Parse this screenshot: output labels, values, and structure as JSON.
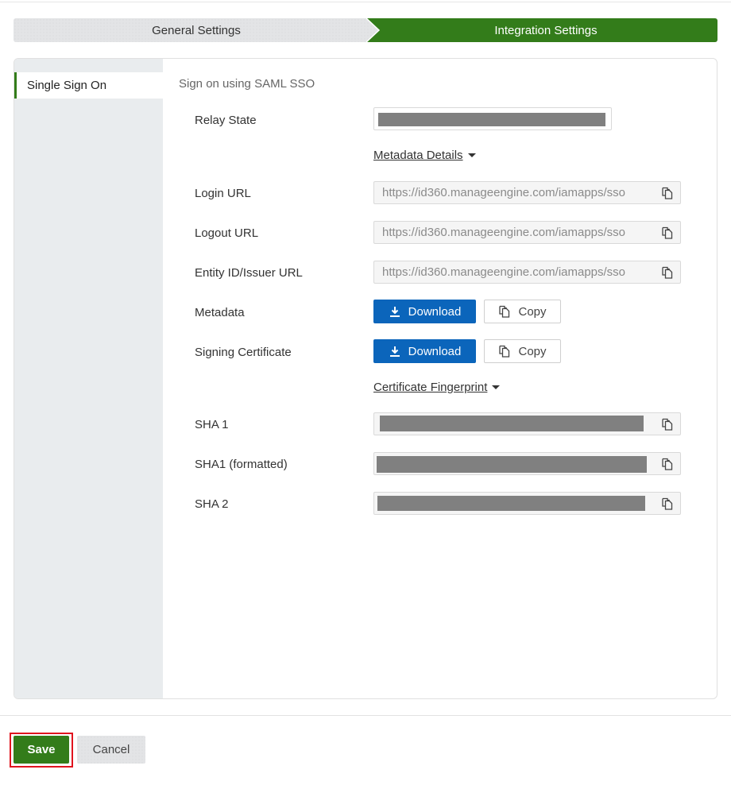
{
  "steps": {
    "general": "General Settings",
    "integration": "Integration Settings",
    "active": "integration"
  },
  "sidenav": {
    "items": [
      {
        "label": "Single Sign On",
        "active": true
      }
    ]
  },
  "content": {
    "section_title": "Sign on using SAML SSO",
    "relay_state": {
      "label": "Relay State",
      "value": "[redacted]"
    },
    "metadata_toggle": "Metadata Details",
    "login_url": {
      "label": "Login URL",
      "value": "https://id360.manageengine.com/iamapps/sso"
    },
    "logout_url": {
      "label": "Logout URL",
      "value": "https://id360.manageengine.com/iamapps/sso"
    },
    "entity_id": {
      "label": "Entity ID/Issuer URL",
      "value": "https://id360.manageengine.com/iamapps/sso"
    },
    "metadata": {
      "label": "Metadata",
      "download": "Download",
      "copy": "Copy"
    },
    "signing_cert": {
      "label": "Signing Certificate",
      "download": "Download",
      "copy": "Copy"
    },
    "fingerprint_toggle": "Certificate Fingerprint",
    "sha1": {
      "label": "SHA 1",
      "value": "[redacted]"
    },
    "sha1_formatted": {
      "label": "SHA1 (formatted)",
      "value": "[redacted]"
    },
    "sha2": {
      "label": "SHA 2",
      "value": "[redacted]"
    }
  },
  "footer": {
    "save": "Save",
    "cancel": "Cancel"
  },
  "icons": {
    "copy": "copy-icon",
    "download": "download-icon",
    "caret": "caret-down-icon"
  },
  "colors": {
    "primary_green": "#337c1a",
    "download_blue": "#0b65bb",
    "highlight_red": "#e0141e",
    "redaction_gray": "#808080"
  }
}
